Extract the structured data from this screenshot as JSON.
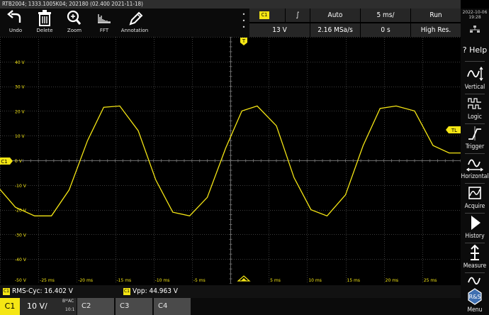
{
  "header": {
    "title": "RTB2004; 1333.1005K04; 202180 (02.400 2021-11-18)",
    "date": "2022-10-06",
    "time": "19:28"
  },
  "toolbar": {
    "items": [
      {
        "label": "Undo",
        "icon": "undo-icon"
      },
      {
        "label": "Delete",
        "icon": "trash-icon"
      },
      {
        "label": "Zoom",
        "icon": "zoom-icon"
      },
      {
        "label": "FFT",
        "icon": "fft-icon"
      },
      {
        "label": "Annotation",
        "icon": "annotation-icon"
      }
    ]
  },
  "status": {
    "channel_tag": "C1",
    "trigger_slope": "∫",
    "trigger_mode": "Auto",
    "time_scale": "5 ms/",
    "run_state": "Run",
    "trigger_level": "13 V",
    "sample_rate": "2.16 MSa/s",
    "time_offset": "0 s",
    "acq_mode": "High Res."
  },
  "side_menu": {
    "items": [
      {
        "label": "Help",
        "icon": "help-icon"
      },
      {
        "label": "Vertical",
        "icon": "vertical-icon"
      },
      {
        "label": "Logic",
        "icon": "logic-icon"
      },
      {
        "label": "Trigger",
        "icon": "trigger-icon"
      },
      {
        "label": "Horizontal",
        "icon": "horizontal-icon"
      },
      {
        "label": "Acquire",
        "icon": "acquire-icon"
      },
      {
        "label": "History",
        "icon": "history-icon"
      },
      {
        "label": "Measure",
        "icon": "measure-icon"
      },
      {
        "label": "Menu",
        "icon": "rs-logo-icon"
      }
    ]
  },
  "plot": {
    "channel_marker": "C1",
    "trigger_level_marker": "TL",
    "trigger_marker": "T",
    "y_labels": [
      "40 V",
      "30 V",
      "20 V",
      "10 V",
      "0 V",
      "-10 V",
      "-20 V",
      "-30 V",
      "-40 V",
      "-50 V"
    ],
    "x_labels": [
      "-25 ms",
      "-20 ms",
      "-15 ms",
      "-10 ms",
      "-5 ms",
      "5 ms",
      "10 ms",
      "15 ms",
      "20 ms",
      "25 ms"
    ]
  },
  "measurements": {
    "tag": "C1",
    "rms_label": "RMS-Cyc: 16.402 V",
    "vpp_label": "Vpp: 44.963 V"
  },
  "channels": {
    "c1_label": "C1",
    "c1_scale": "10 V/",
    "c1_bw": "Bᵂ",
    "c1_coupling": "AC",
    "c1_probe": "10:1",
    "c2_label": "C2",
    "c3_label": "C3",
    "c4_label": "C4"
  },
  "colors": {
    "trace": "#f5e614",
    "accent": "#f5e614",
    "grid": "#3c3c3c"
  },
  "chart_data": {
    "type": "line",
    "xlabel": "",
    "ylabel": "",
    "xlim": [
      -30,
      30
    ],
    "ylim": [
      -50,
      50
    ],
    "grid": true,
    "series": [
      {
        "x": [
          -30.5,
          -28,
          -25.5,
          -23.3,
          -21,
          -18.6,
          -16.5,
          -14.4,
          -12,
          -9.7,
          -7.5,
          -5.3,
          -3,
          -0.6,
          1.5,
          3.5,
          6,
          8.3,
          10.5,
          12.6,
          15,
          17.3,
          19.5,
          21.6,
          24,
          26.4,
          28.5,
          30.5
        ],
        "y": [
          -10,
          -19,
          -22.5,
          -22.5,
          -12,
          8,
          21.5,
          22,
          12,
          -8,
          -21,
          -22.5,
          -15,
          5,
          20,
          22,
          14,
          -7,
          -20,
          -22.5,
          -14,
          6,
          21,
          22,
          20,
          6,
          3,
          3
        ]
      }
    ]
  }
}
